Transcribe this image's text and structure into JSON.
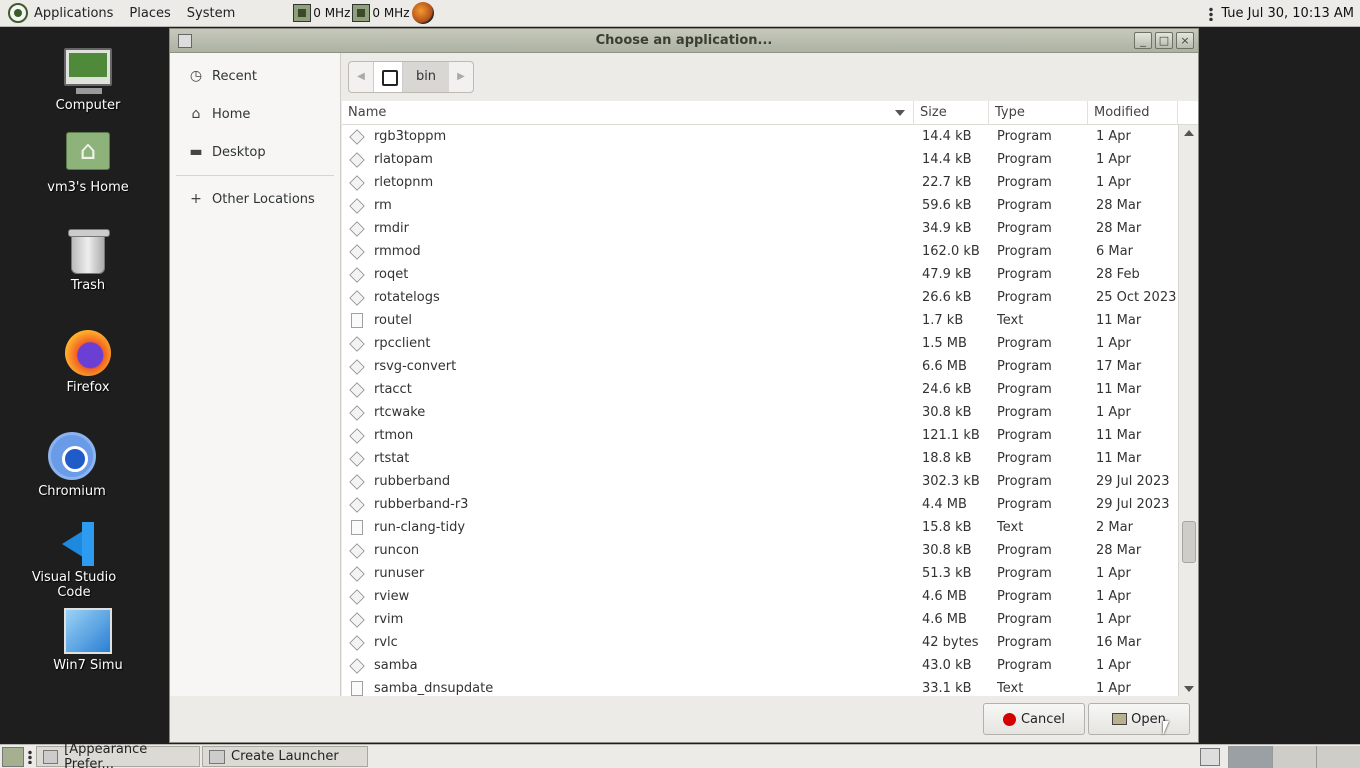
{
  "top_panel": {
    "menus": [
      "Applications",
      "Places",
      "System"
    ],
    "cpu1": "0 MHz",
    "cpu2": "0 MHz",
    "datetime": "Tue Jul 30, 10:13 AM"
  },
  "desktop": {
    "icons": [
      {
        "label": "Computer",
        "icon": "computer-icon"
      },
      {
        "label": "vm3's Home",
        "icon": "home-folder-icon"
      },
      {
        "label": "Trash",
        "icon": "trash-icon"
      },
      {
        "label": "Firefox",
        "icon": "firefox-icon"
      },
      {
        "label": "Chromium",
        "icon": "chromium-icon"
      },
      {
        "label": "Visual Studio Code",
        "icon": "vscode-icon"
      },
      {
        "label": "Win7 Simu",
        "icon": "win7-icon"
      }
    ]
  },
  "dialog": {
    "title": "Choose an application...",
    "sidebar": {
      "items": [
        {
          "label": "Recent",
          "icon": "clock-icon"
        },
        {
          "label": "Home",
          "icon": "home-icon"
        },
        {
          "label": "Desktop",
          "icon": "folder-icon"
        }
      ],
      "other": {
        "label": "Other Locations",
        "icon": "plus-icon"
      }
    },
    "path": {
      "current": "bin"
    },
    "columns": {
      "name": "Name",
      "size": "Size",
      "type": "Type",
      "modified": "Modified"
    },
    "files": [
      {
        "name": "rgb3toppm",
        "size": "14.4 kB",
        "type": "Program",
        "modified": "1 Apr",
        "kind": "exe"
      },
      {
        "name": "rlatopam",
        "size": "14.4 kB",
        "type": "Program",
        "modified": "1 Apr",
        "kind": "exe"
      },
      {
        "name": "rletopnm",
        "size": "22.7 kB",
        "type": "Program",
        "modified": "1 Apr",
        "kind": "exe"
      },
      {
        "name": "rm",
        "size": "59.6 kB",
        "type": "Program",
        "modified": "28 Mar",
        "kind": "exe"
      },
      {
        "name": "rmdir",
        "size": "34.9 kB",
        "type": "Program",
        "modified": "28 Mar",
        "kind": "exe"
      },
      {
        "name": "rmmod",
        "size": "162.0 kB",
        "type": "Program",
        "modified": "6 Mar",
        "kind": "exe"
      },
      {
        "name": "roqet",
        "size": "47.9 kB",
        "type": "Program",
        "modified": "28 Feb",
        "kind": "exe"
      },
      {
        "name": "rotatelogs",
        "size": "26.6 kB",
        "type": "Program",
        "modified": "25 Oct 2023",
        "kind": "exe"
      },
      {
        "name": "routel",
        "size": "1.7 kB",
        "type": "Text",
        "modified": "11 Mar",
        "kind": "txt"
      },
      {
        "name": "rpcclient",
        "size": "1.5 MB",
        "type": "Program",
        "modified": "1 Apr",
        "kind": "exe"
      },
      {
        "name": "rsvg-convert",
        "size": "6.6 MB",
        "type": "Program",
        "modified": "17 Mar",
        "kind": "exe"
      },
      {
        "name": "rtacct",
        "size": "24.6 kB",
        "type": "Program",
        "modified": "11 Mar",
        "kind": "exe"
      },
      {
        "name": "rtcwake",
        "size": "30.8 kB",
        "type": "Program",
        "modified": "1 Apr",
        "kind": "exe"
      },
      {
        "name": "rtmon",
        "size": "121.1 kB",
        "type": "Program",
        "modified": "11 Mar",
        "kind": "exe"
      },
      {
        "name": "rtstat",
        "size": "18.8 kB",
        "type": "Program",
        "modified": "11 Mar",
        "kind": "exe"
      },
      {
        "name": "rubberband",
        "size": "302.3 kB",
        "type": "Program",
        "modified": "29 Jul 2023",
        "kind": "exe"
      },
      {
        "name": "rubberband-r3",
        "size": "4.4 MB",
        "type": "Program",
        "modified": "29 Jul 2023",
        "kind": "exe"
      },
      {
        "name": "run-clang-tidy",
        "size": "15.8 kB",
        "type": "Text",
        "modified": "2 Mar",
        "kind": "txt"
      },
      {
        "name": "runcon",
        "size": "30.8 kB",
        "type": "Program",
        "modified": "28 Mar",
        "kind": "exe"
      },
      {
        "name": "runuser",
        "size": "51.3 kB",
        "type": "Program",
        "modified": "1 Apr",
        "kind": "exe"
      },
      {
        "name": "rview",
        "size": "4.6 MB",
        "type": "Program",
        "modified": "1 Apr",
        "kind": "exe"
      },
      {
        "name": "rvim",
        "size": "4.6 MB",
        "type": "Program",
        "modified": "1 Apr",
        "kind": "exe"
      },
      {
        "name": "rvlc",
        "size": "42 bytes",
        "type": "Program",
        "modified": "16 Mar",
        "kind": "exe"
      },
      {
        "name": "samba",
        "size": "43.0 kB",
        "type": "Program",
        "modified": "1 Apr",
        "kind": "exe"
      },
      {
        "name": "samba_dnsupdate",
        "size": "33.1 kB",
        "type": "Text",
        "modified": "1 Apr",
        "kind": "txt"
      }
    ],
    "buttons": {
      "cancel": "Cancel",
      "open": "Open"
    }
  },
  "taskbar": {
    "tasks": [
      "[Appearance Prefer...",
      "Create Launcher"
    ]
  },
  "colors": {
    "cancel_icon": "#d40000",
    "titlebar": "#b5baa9"
  }
}
